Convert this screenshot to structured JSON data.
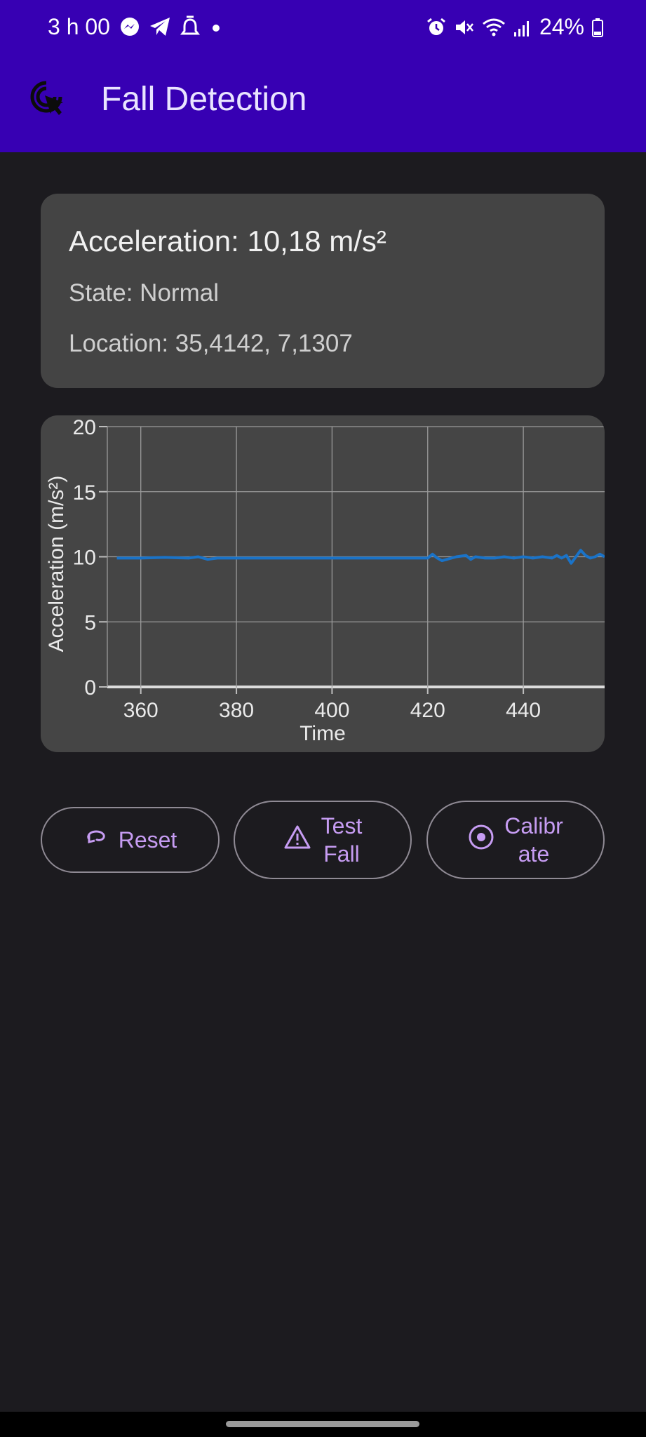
{
  "status_bar": {
    "time": "3 h 00",
    "battery": "24%",
    "left_icons": [
      "messenger-icon",
      "telegram-icon",
      "alarm-bell-icon",
      "dot-icon"
    ],
    "right_icons": [
      "alarm-clock-icon",
      "mute-icon",
      "wifi-icon",
      "signal-icon",
      "battery-icon"
    ]
  },
  "app_bar": {
    "icon": "fall-detection-cursor-icon",
    "title": "Fall Detection",
    "background": "#3700b3"
  },
  "info_card": {
    "acceleration": "Acceleration: 10,18 m/s²",
    "state": "State: Normal",
    "location": "Location: 35,4142, 7,1307"
  },
  "chart_data": {
    "type": "line",
    "title": "",
    "xlabel": "Time",
    "ylabel": "Acceleration (m/s²)",
    "xlim": [
      353,
      457
    ],
    "ylim": [
      0,
      20
    ],
    "x_ticks": [
      "360",
      "380",
      "400",
      "420",
      "440"
    ],
    "y_ticks": [
      "0",
      "5",
      "10",
      "15",
      "20"
    ],
    "grid": true,
    "series": [
      {
        "color": "#1a73c8",
        "x": [
          355,
          360,
          365,
          370,
          372,
          374,
          376,
          380,
          390,
          400,
          410,
          420,
          421,
          422,
          423,
          424,
          426,
          428,
          429,
          430,
          432,
          434,
          436,
          438,
          440,
          442,
          444,
          446,
          447,
          448,
          449,
          450,
          451,
          452,
          453,
          454,
          455,
          456,
          457
        ],
        "values": [
          9.9,
          9.9,
          9.95,
          9.9,
          10.0,
          9.8,
          9.9,
          9.9,
          9.9,
          9.9,
          9.9,
          9.9,
          10.2,
          9.9,
          9.7,
          9.8,
          10.0,
          10.1,
          9.8,
          10.0,
          9.9,
          9.9,
          10.0,
          9.9,
          10.0,
          9.9,
          10.0,
          9.9,
          10.1,
          9.9,
          10.1,
          9.5,
          10.0,
          10.5,
          10.1,
          9.9,
          10.0,
          10.2,
          10.0
        ]
      }
    ]
  },
  "buttons": {
    "reset": {
      "label": "Reset",
      "icon": "reset-icon"
    },
    "test_fall": {
      "line1": "Test",
      "line2": "Fall",
      "icon": "warning-icon"
    },
    "calibrate": {
      "line1": "Calibr",
      "line2": "ate",
      "icon": "target-icon"
    }
  },
  "colors": {
    "background": "#1c1b1f",
    "card": "#444444",
    "button_text": "#c69cf2"
  }
}
